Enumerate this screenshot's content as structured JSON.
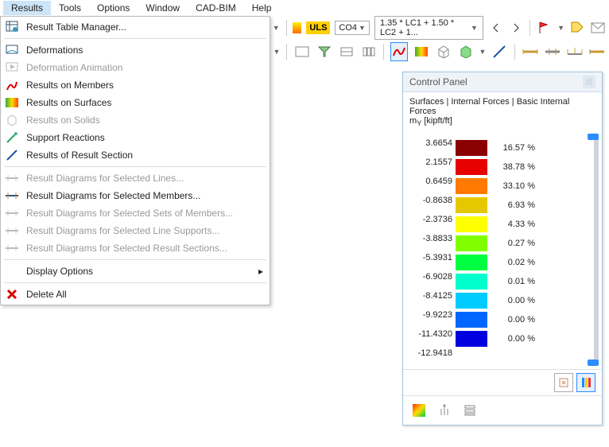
{
  "menubar": [
    "Results",
    "Tools",
    "Options",
    "Window",
    "CAD-BIM",
    "Help"
  ],
  "active_menu": 0,
  "dropdown": {
    "items": [
      {
        "label": "Result Table Manager...",
        "enabled": true,
        "icon": "table-mgr"
      },
      {
        "sep": true
      },
      {
        "label": "Deformations",
        "enabled": true,
        "icon": "deform"
      },
      {
        "label": "Deformation Animation",
        "enabled": false,
        "icon": "anim"
      },
      {
        "label": "Results on Members",
        "enabled": true,
        "icon": "members"
      },
      {
        "label": "Results on Surfaces",
        "enabled": true,
        "icon": "surfaces"
      },
      {
        "label": "Results on Solids",
        "enabled": false,
        "icon": "solids"
      },
      {
        "label": "Support Reactions",
        "enabled": true,
        "icon": "reactions"
      },
      {
        "label": "Results of Result Section",
        "enabled": true,
        "icon": "section"
      },
      {
        "sep": true
      },
      {
        "label": "Result Diagrams for Selected Lines...",
        "enabled": false,
        "icon": "diag-lines"
      },
      {
        "label": "Result Diagrams for Selected Members...",
        "enabled": true,
        "icon": "diag-members"
      },
      {
        "label": "Result Diagrams for Selected Sets of Members...",
        "enabled": false,
        "icon": "diag-sets"
      },
      {
        "label": "Result Diagrams for Selected Line Supports...",
        "enabled": false,
        "icon": "diag-supports"
      },
      {
        "label": "Result Diagrams for Selected Result Sections...",
        "enabled": false,
        "icon": "diag-sections"
      },
      {
        "sep": true
      },
      {
        "label": "Display Options",
        "enabled": true,
        "icon": "",
        "submenu": true
      },
      {
        "sep": true
      },
      {
        "label": "Delete All",
        "enabled": true,
        "icon": "delete"
      }
    ]
  },
  "toolbar": {
    "uls_label": "ULS",
    "co_label": "CO4",
    "formula": "1.35 * LC1 + 1.50 * LC2 + 1..."
  },
  "control_panel": {
    "title": "Control Panel",
    "subtitle": "Surfaces | Internal Forces | Basic Internal Forces",
    "unit_label": "m",
    "unit_sub": "Y",
    "unit_suffix": " [kipft/ft]",
    "legend": {
      "values": [
        "3.6654",
        "2.1557",
        "0.6459",
        "-0.8638",
        "-2.3736",
        "-3.8833",
        "-5.3931",
        "-6.9028",
        "-8.4125",
        "-9.9223",
        "-11.4320",
        "-12.9418"
      ],
      "percents": [
        "16.57 %",
        "38.78 %",
        "33.10 %",
        "6.93 %",
        "4.33 %",
        "0.27 %",
        "0.02 %",
        "0.01 %",
        "0.00 %",
        "0.00 %",
        "0.00 %"
      ],
      "colors": [
        "#8b0000",
        "#e60000",
        "#ff7a00",
        "#e6c800",
        "#ffff00",
        "#80ff00",
        "#00ff40",
        "#00ffcc",
        "#00ccff",
        "#0066ff",
        "#0000e0",
        "#000080"
      ]
    }
  }
}
